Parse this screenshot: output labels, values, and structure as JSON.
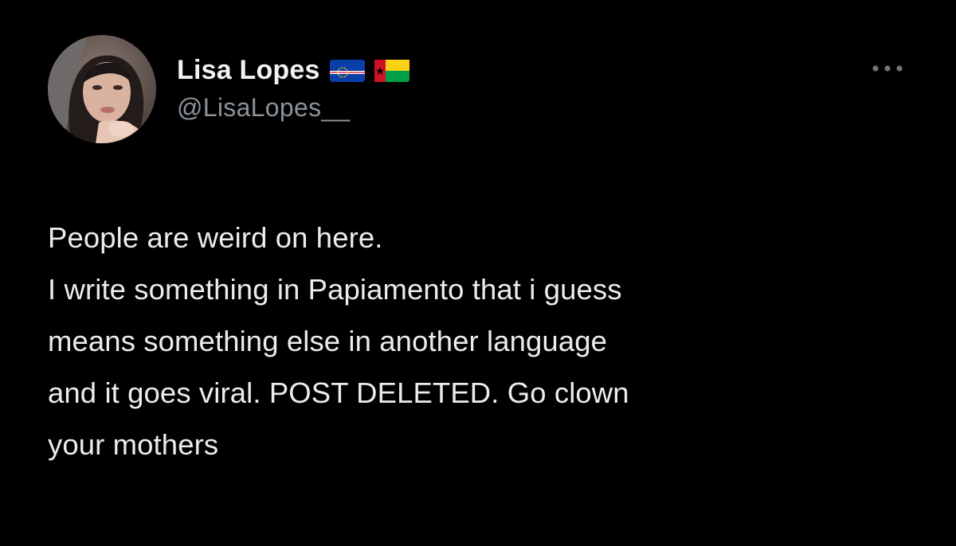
{
  "user": {
    "display_name": "Lisa Lopes",
    "handle": "@LisaLopes__",
    "flags": [
      "cape-verde-flag",
      "guinea-bissau-flag"
    ]
  },
  "menu": {
    "icon": "more-horizontal-icon"
  },
  "tweet": {
    "lines": [
      "People are weird on here.",
      "I write something in Papiamento that i guess",
      "means something else in another language",
      "and it goes viral. POST DELETED. Go clown",
      "your mothers"
    ]
  },
  "colors": {
    "background": "#000000",
    "name": "#f2f2f2",
    "handle": "#8b9299",
    "text": "#ececec"
  }
}
